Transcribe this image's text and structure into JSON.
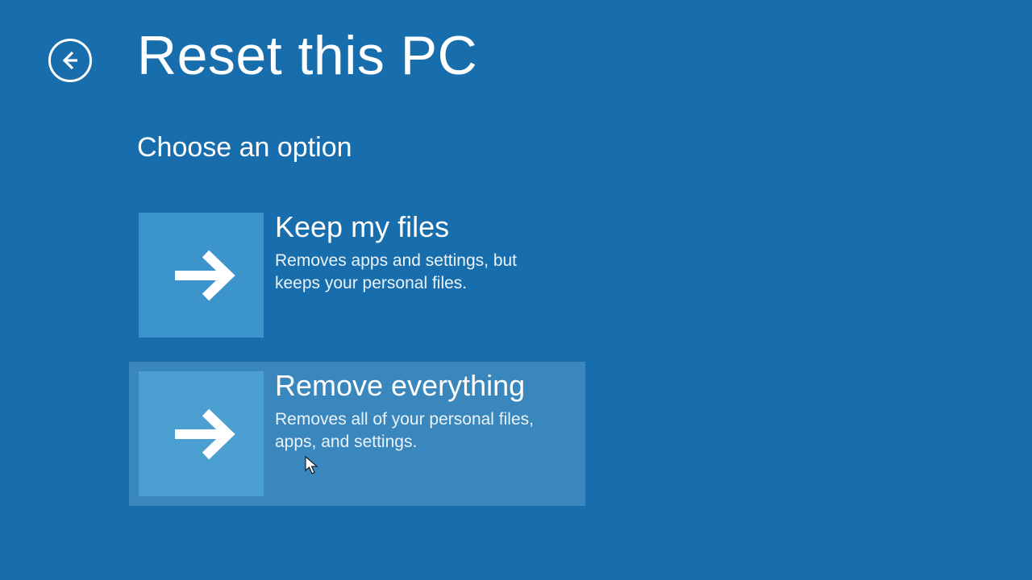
{
  "header": {
    "title": "Reset this PC",
    "subtitle": "Choose an option"
  },
  "options": [
    {
      "title": "Keep my files",
      "description": "Removes apps and settings, but keeps your personal files."
    },
    {
      "title": "Remove everything",
      "description": "Removes all of your personal files, apps, and settings."
    }
  ]
}
